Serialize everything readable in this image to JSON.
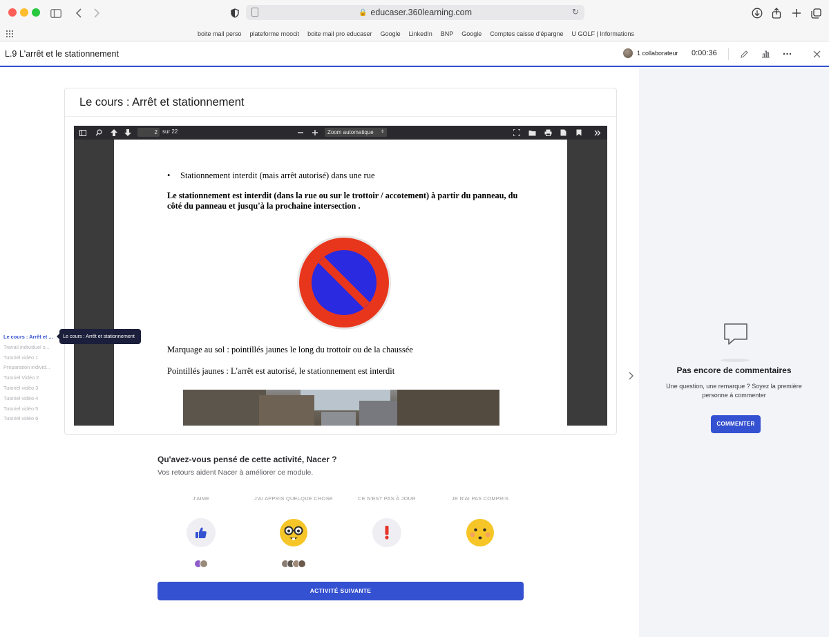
{
  "browser": {
    "url": "educaser.360learning.com",
    "bookmarks": [
      "boite mail perso",
      "plateforme moocit",
      "boite mail pro educaser",
      "Google",
      "LinkedIn",
      "BNP",
      "Google",
      "Comptes caisse d'épargne",
      "U GOLF | Informations"
    ]
  },
  "header": {
    "title": "L.9 L'arrêt et le stationnement",
    "collaborators": "1 collaborateur",
    "timer": "0:00:36"
  },
  "course": {
    "title": "Le cours : Arrêt et stationnement",
    "pdf": {
      "page_value": "2",
      "page_of": "sur 22",
      "zoom": "Zoom automatique",
      "bullet": "Stationnement interdit (mais arrêt autorisé) dans une rue",
      "bold_paragraph": "Le stationnement est interdit (dans la rue ou sur le trottoir / accotement) à partir du panneau, du côté du panneau et jusqu'à la prochaine intersection .",
      "line1": "Marquage au sol : pointillés jaunes le long du trottoir ou de la chaussée",
      "line2": "Pointillés jaunes : L'arrêt est autorisé, le stationnement est interdit"
    }
  },
  "nav": {
    "items": [
      "Le cours : Arrêt et ...",
      "Travail individuel s...",
      "Tutoriel vidéo 1",
      "Préparation individ...",
      "Tutoriel Vidéo 2",
      "Tutoriel vidéo 3",
      "Tutoriel vidéo 4",
      "Tutoriel vidéo 5",
      "Tutoriel vidéo 6"
    ],
    "tooltip": "Le cours : Arrêt et stationnement"
  },
  "feedback": {
    "title": "Qu'avez-vous pensé de cette activité, Nacer ?",
    "subtitle": "Vos retours aident Nacer à améliorer ce module.",
    "options": [
      {
        "label": "J'AIME",
        "icon": "thumbs-up-icon"
      },
      {
        "label": "J'AI APPRIS QUELQUE CHOSE",
        "icon": "nerd-face-icon"
      },
      {
        "label": "CE N'EST PAS À JOUR",
        "icon": "exclamation-icon"
      },
      {
        "label": "JE N'AI PAS COMPRIS",
        "icon": "confused-face-icon"
      }
    ],
    "next_button": "ACTIVITÉ SUIVANTE"
  },
  "comments": {
    "title": "Pas encore de commentaires",
    "text": "Une question, une remarque ? Soyez la première personne à commenter",
    "button": "COMMENTER"
  },
  "colors": {
    "accent": "#3451d1",
    "sign_red": "#e8361c",
    "sign_blue": "#2a2ae0",
    "panel_bg": "#f3f4f8"
  }
}
